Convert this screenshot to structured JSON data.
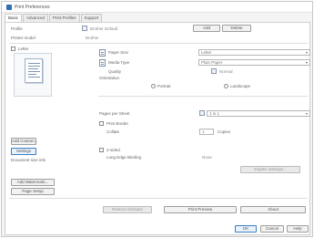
{
  "window": {
    "title": "Print Preferences"
  },
  "tabs": [
    "Basic",
    "Advanced",
    "Print Profiles",
    "Support"
  ],
  "top": {
    "profile_label": "Profile",
    "profile_value": "Brother Default",
    "add_label": "Add",
    "delete_label": "Delete",
    "sub_label": "Printer model",
    "sub_value": "Brother"
  },
  "left": {
    "size_label": "Letter",
    "custom_btn": "Add Custom...",
    "settings_btn": "Settings",
    "info_text": "Document size info",
    "watermark_btn": "Add Watermark...",
    "layout_btn": "Page Setup"
  },
  "settings": {
    "paper_size_label": "Paper Size",
    "paper_size_value": "Letter",
    "media_label": "Media Type",
    "media_value": "Plain Paper",
    "quality_label": "Quality",
    "quality_value": "Normal",
    "orientation_label": "Orientation",
    "portrait": "Portrait",
    "landscape": "Landscape",
    "pages_label": "Pages per Sheet",
    "pages_value": "1 in 1",
    "border_label": "Print Border",
    "collate_label": "Collate",
    "copies_value": "1",
    "copies_label": "Copies",
    "duplex_label": "2-sided",
    "duplex_sub": "Long Edge Binding",
    "duplex_value": "None",
    "duplex_btn": "Duplex Settings..."
  },
  "footer": {
    "defaults_btn": "Restore Defaults",
    "preview_btn": "Print Preview",
    "about_btn": "About",
    "ok_btn": "OK",
    "cancel_btn": "Cancel",
    "help_btn": "Help"
  },
  "colors": {
    "accent": "#3c7fc7",
    "frame": "#c8c8c8"
  },
  "icons": [
    "app-icon",
    "document-icon",
    "chevron-down-icon",
    "printer-icon"
  ]
}
